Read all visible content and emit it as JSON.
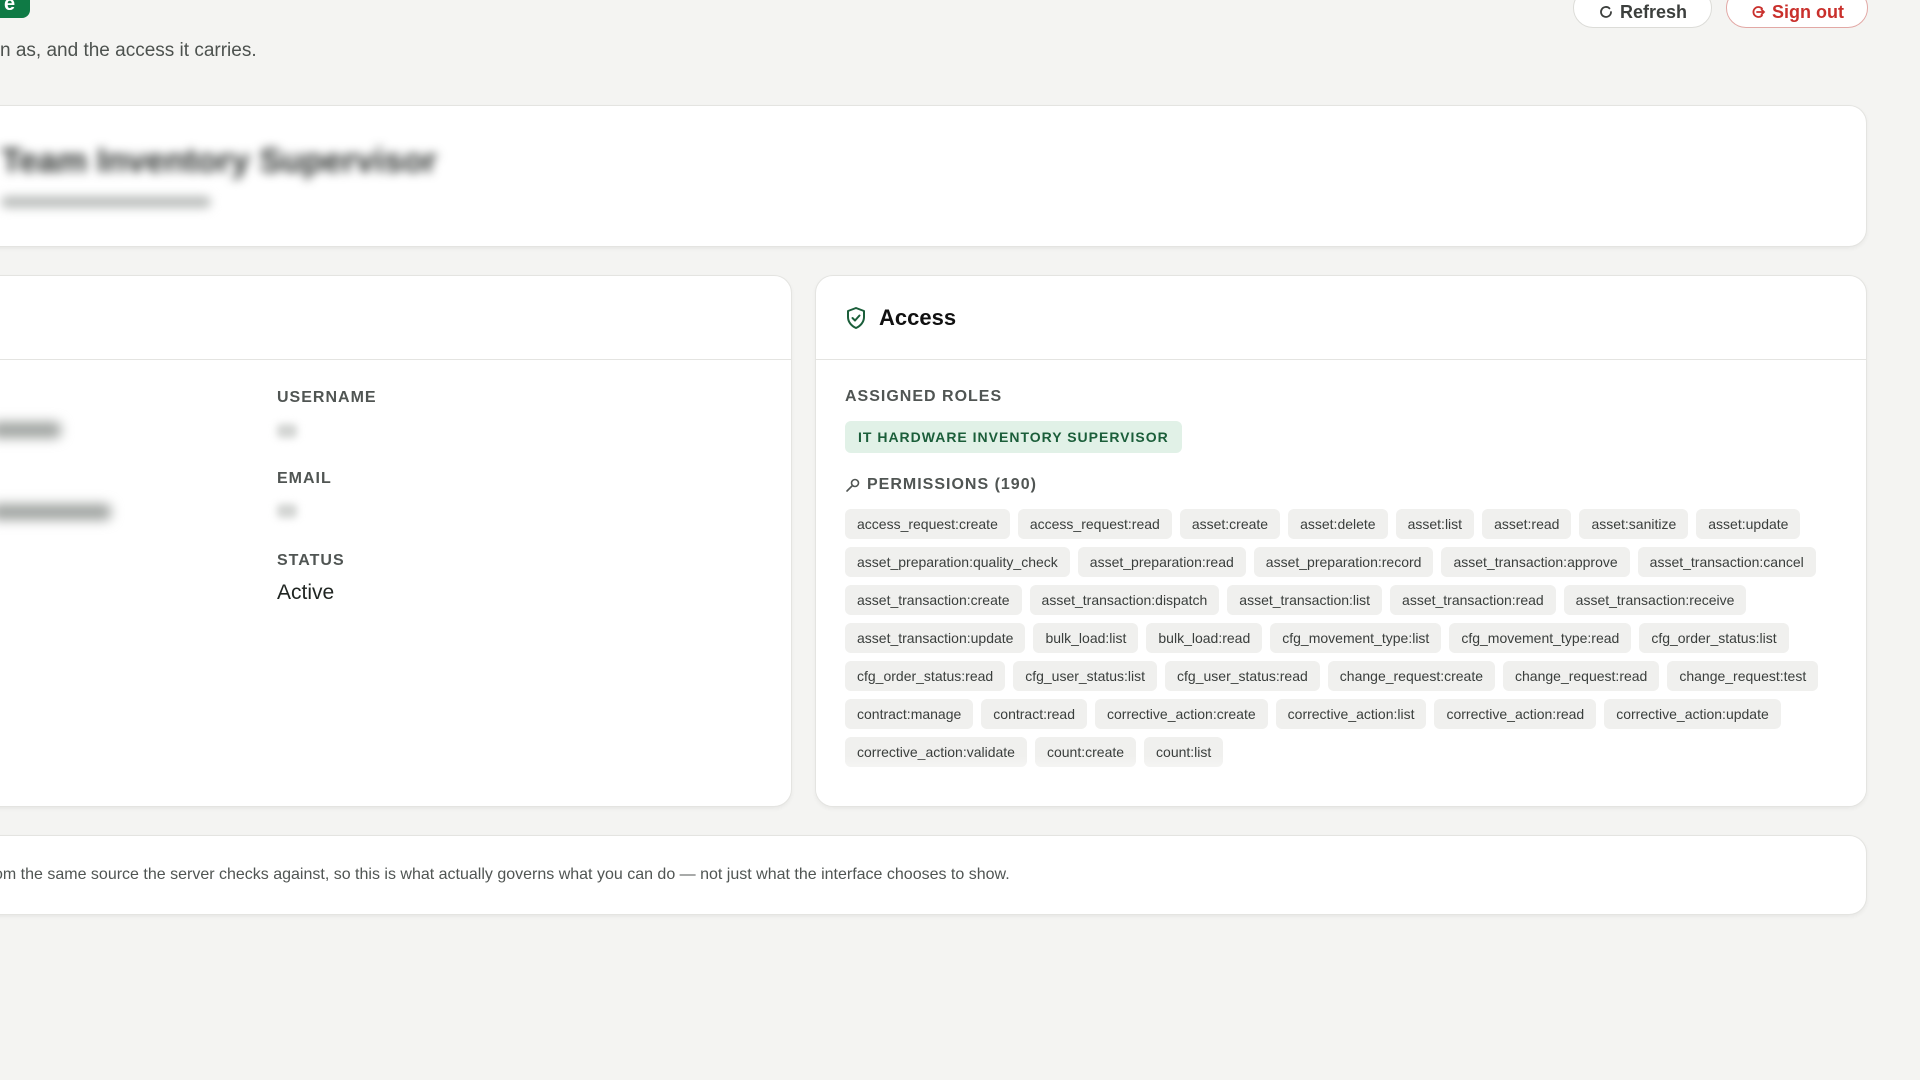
{
  "header": {
    "logo_letter": "e",
    "subtitle": "n as, and the access it carries.",
    "refresh_label": "Refresh",
    "signout_label": "Sign out"
  },
  "profile_card": {
    "blurred_title": "Team Inventory Supervisor"
  },
  "details": {
    "username_label": "USERNAME",
    "email_label": "EMAIL",
    "status_label": "STATUS",
    "status_value": "Active"
  },
  "access": {
    "title": "Access",
    "roles_label": "ASSIGNED ROLES",
    "roles": [
      "IT HARDWARE INVENTORY SUPERVISOR"
    ],
    "permissions_label": "PERMISSIONS (190)",
    "permissions": [
      "access_request:create",
      "access_request:read",
      "asset:create",
      "asset:delete",
      "asset:list",
      "asset:read",
      "asset:sanitize",
      "asset:update",
      "asset_preparation:quality_check",
      "asset_preparation:read",
      "asset_preparation:record",
      "asset_transaction:approve",
      "asset_transaction:cancel",
      "asset_transaction:create",
      "asset_transaction:dispatch",
      "asset_transaction:list",
      "asset_transaction:read",
      "asset_transaction:receive",
      "asset_transaction:update",
      "bulk_load:list",
      "bulk_load:read",
      "cfg_movement_type:list",
      "cfg_movement_type:read",
      "cfg_order_status:list",
      "cfg_order_status:read",
      "cfg_user_status:list",
      "cfg_user_status:read",
      "change_request:create",
      "change_request:read",
      "change_request:test",
      "contract:manage",
      "contract:read",
      "corrective_action:create",
      "corrective_action:list",
      "corrective_action:read",
      "corrective_action:update",
      "corrective_action:validate",
      "count:create",
      "count:list"
    ]
  },
  "note": {
    "text": "om the same source the server checks against, so this is what actually governs what you can do — not just what the interface chooses to show."
  },
  "colors": {
    "brand": "#0f7a45",
    "danger": "#c9302c",
    "role_badge_bg": "#e1f1e7",
    "chip_bg": "#f0f0ee"
  }
}
